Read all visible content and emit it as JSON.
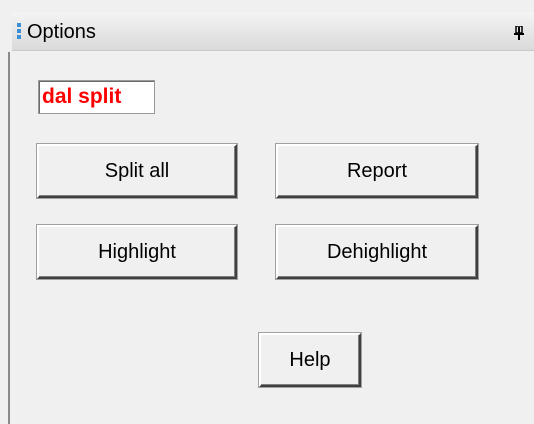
{
  "panel": {
    "title": "Options",
    "grip_icon": "grip-dots",
    "pin_icon": "pin"
  },
  "label": {
    "text": "dal split",
    "color": "#ff0000"
  },
  "buttons": {
    "split_all": "Split all",
    "report": "Report",
    "highlight": "Highlight",
    "dehighlight": "Dehighlight",
    "help": "Help"
  }
}
